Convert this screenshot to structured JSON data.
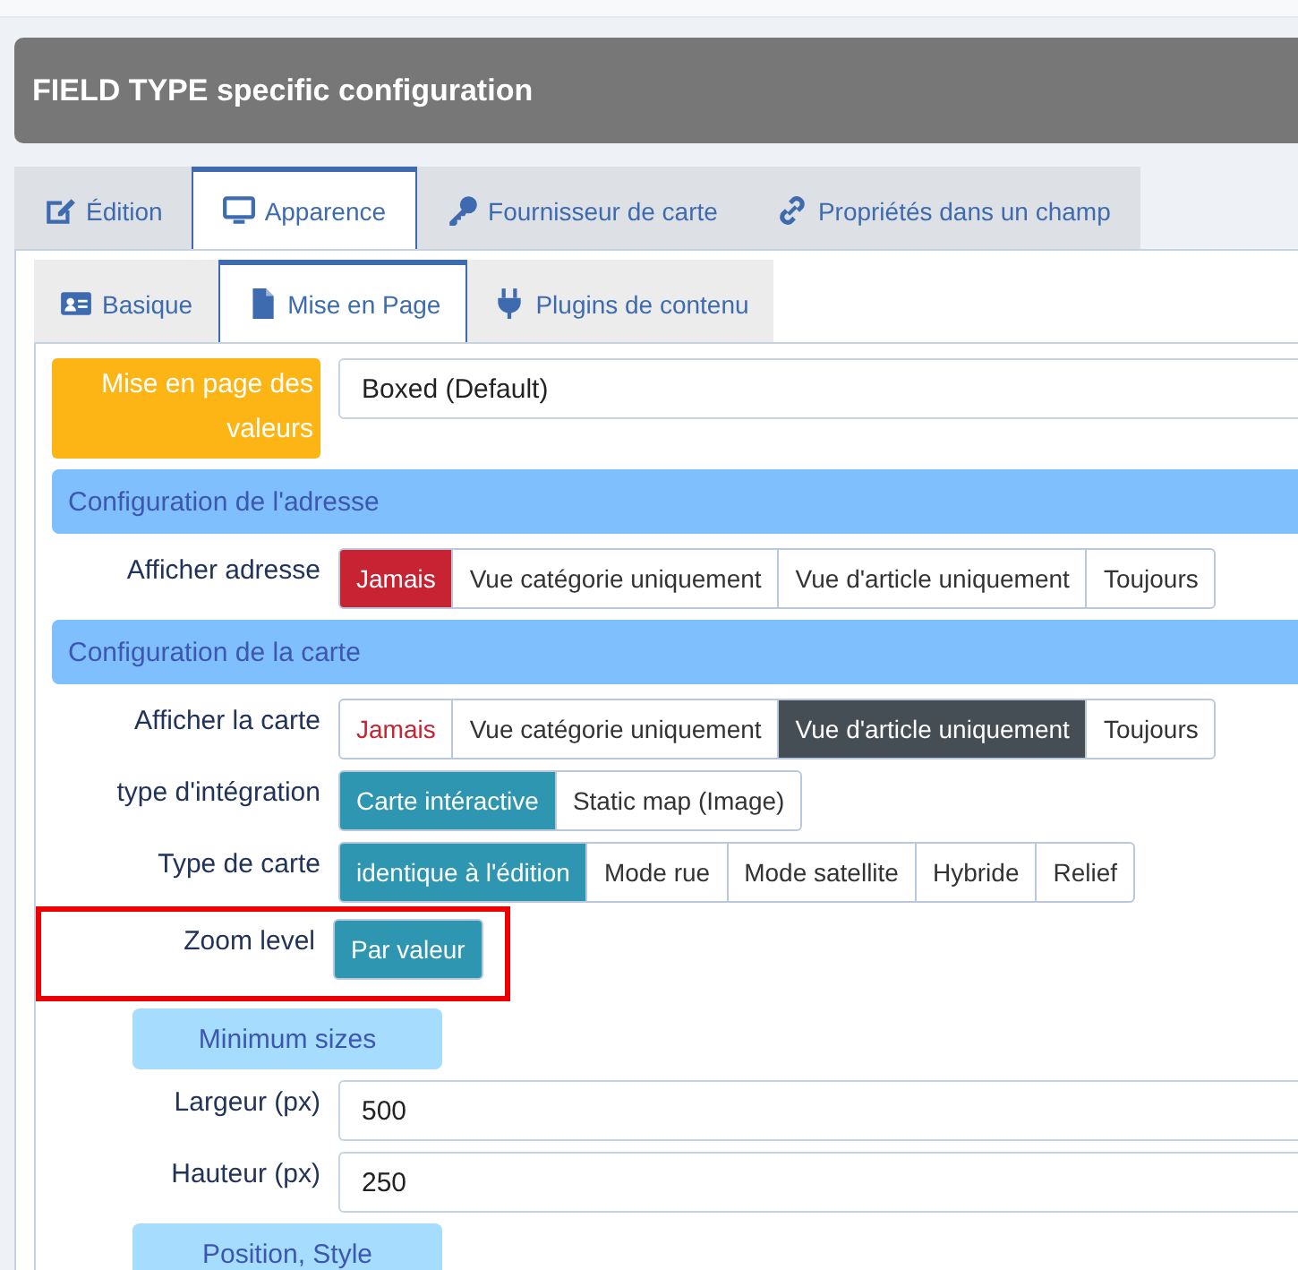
{
  "header": {
    "title": "FIELD TYPE specific configuration"
  },
  "tabs": [
    {
      "label": "Édition",
      "selected": false
    },
    {
      "label": "Apparence",
      "selected": true
    },
    {
      "label": "Fournisseur de carte",
      "selected": false
    },
    {
      "label": "Propriétés dans un champ",
      "selected": false
    }
  ],
  "subtabs": [
    {
      "label": "Basique",
      "selected": false
    },
    {
      "label": "Mise en Page",
      "selected": true
    },
    {
      "label": "Plugins de contenu",
      "selected": false
    }
  ],
  "rows": [
    {
      "kind": "select",
      "label": "Mise en page des valeurs",
      "value": "Boxed (Default)"
    },
    {
      "kind": "section",
      "label": "Configuration de l'adresse"
    },
    {
      "kind": "buttons",
      "label": "Afficher adresse",
      "highlighted": false,
      "options": [
        {
          "label": "Jamais",
          "kind": "danger",
          "selected": true
        },
        {
          "label": "Vue catégorie uniquement",
          "kind": "normal",
          "selected": false
        },
        {
          "label": "Vue d'article uniquement",
          "kind": "normal",
          "selected": false
        },
        {
          "label": "Toujours",
          "kind": "normal",
          "selected": false
        }
      ]
    },
    {
      "kind": "section",
      "label": "Configuration de la carte"
    },
    {
      "kind": "buttons",
      "label": "Afficher la carte",
      "highlighted": false,
      "options": [
        {
          "label": "Jamais",
          "kind": "danger",
          "selected": false
        },
        {
          "label": "Vue catégorie uniquement",
          "kind": "normal",
          "selected": false
        },
        {
          "label": "Vue d'article uniquement",
          "kind": "dark",
          "selected": true
        },
        {
          "label": "Toujours",
          "kind": "normal",
          "selected": false
        }
      ]
    },
    {
      "kind": "buttons",
      "label": "type d'intégration",
      "highlighted": false,
      "options": [
        {
          "label": "Carte intéractive",
          "kind": "normal",
          "selected": true
        },
        {
          "label": "Static map (Image)",
          "kind": "normal",
          "selected": false
        }
      ]
    },
    {
      "kind": "buttons",
      "label": "Type de carte",
      "highlighted": false,
      "options": [
        {
          "label": "identique à l'édition",
          "kind": "normal",
          "selected": true
        },
        {
          "label": "Mode rue",
          "kind": "normal",
          "selected": false
        },
        {
          "label": "Mode satellite",
          "kind": "normal",
          "selected": false
        },
        {
          "label": "Hybride",
          "kind": "normal",
          "selected": false
        },
        {
          "label": "Relief",
          "kind": "normal",
          "selected": false
        }
      ]
    },
    {
      "kind": "buttons",
      "label": "Zoom level",
      "highlighted": true,
      "options": [
        {
          "label": "Par valeur",
          "kind": "normal",
          "selected": true
        }
      ]
    },
    {
      "kind": "subsection",
      "label": "Minimum sizes"
    },
    {
      "kind": "input",
      "label": "Largeur (px)",
      "value": "500"
    },
    {
      "kind": "input",
      "label": "Hauteur (px)",
      "value": "250"
    },
    {
      "kind": "subsection",
      "label": "Position, Style"
    }
  ]
}
